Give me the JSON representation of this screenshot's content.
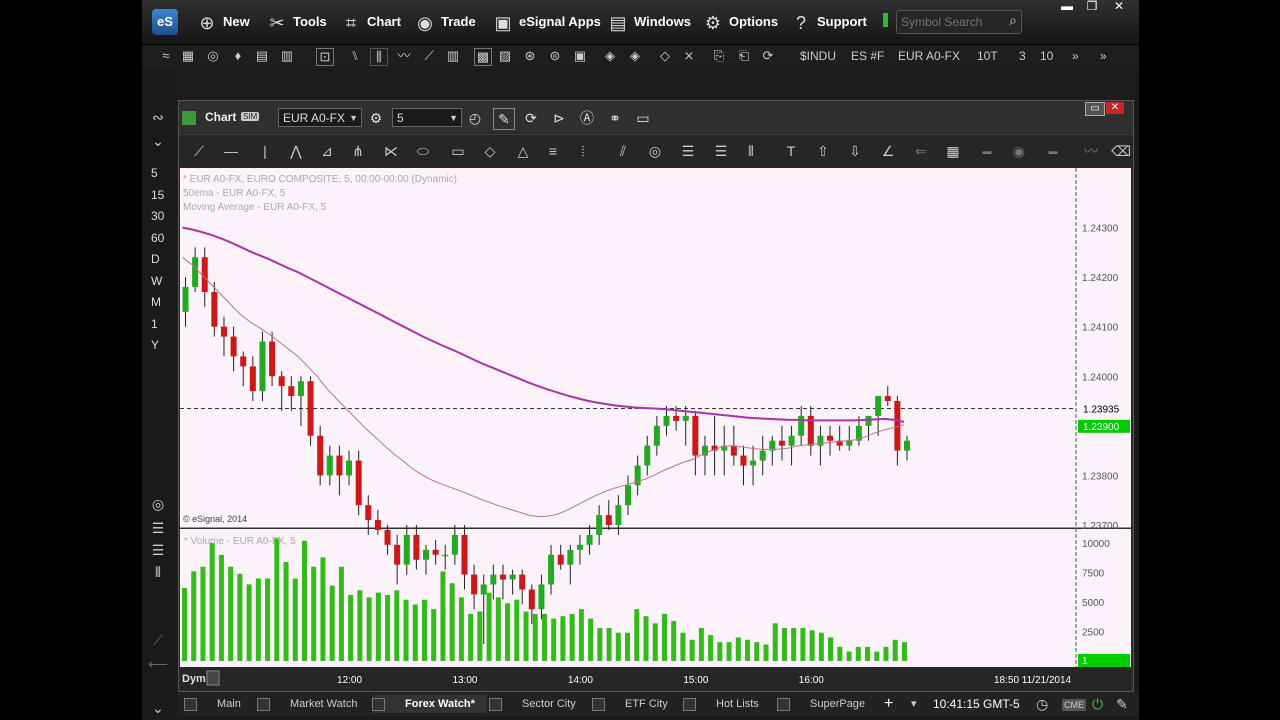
{
  "menu": {
    "logo": "eS",
    "items": [
      "New",
      "Tools",
      "Chart",
      "Trade",
      "eSignal Apps",
      "Windows",
      "Options",
      "Support"
    ],
    "search_placeholder": "Symbol Search"
  },
  "toolbar": {
    "symbols": [
      "$INDU",
      "ES #F",
      "EUR A0-FX",
      "10T",
      "3",
      "10"
    ]
  },
  "gutter": {
    "intervals": [
      "5",
      "15",
      "30",
      "60",
      "D",
      "W",
      "M",
      "1",
      "Y"
    ]
  },
  "chart_window": {
    "title": "Chart",
    "mode_badge": "SIM",
    "symbol": "EUR A0-FX",
    "interval": "5"
  },
  "colors": {
    "up": "#22aa22",
    "down": "#cc1818",
    "ma50": "#aa33aa",
    "ma": "#c07088",
    "volume": "#33bb1a",
    "plot_bg": "#fcf2fa",
    "last_price": "#00cc00"
  },
  "chart_data": [
    {
      "type": "candlestick",
      "title": "* EUR A0-FX, EURO COMPOSITE, 5, 00:00-00:00 (Dynamic)",
      "studies": [
        "50ema - EUR A0-FX, 5",
        "Moving Average - EUR A0-FX, 5"
      ],
      "watermark": "© eSignal, 2014",
      "ylim": [
        1.237,
        1.2442
      ],
      "yticks": [
        "1.24300",
        "1.24200",
        "1.24100",
        "1.24000",
        "1.23800",
        "1.23700"
      ],
      "ytick_values": [
        1.243,
        1.242,
        1.241,
        1.24,
        1.238,
        1.237
      ],
      "crosshair_price": "1.23935",
      "crosshair_value": 1.23935,
      "last_price": "1.23900",
      "last_value": 1.239,
      "candles": [
        [
          1.2413,
          1.242,
          1.241,
          1.2418
        ],
        [
          1.2418,
          1.2426,
          1.2417,
          1.2424
        ],
        [
          1.2424,
          1.2426,
          1.2414,
          1.2417
        ],
        [
          1.2417,
          1.2419,
          1.2408,
          1.241
        ],
        [
          1.241,
          1.2412,
          1.2404,
          1.2408
        ],
        [
          1.2408,
          1.241,
          1.2401,
          1.2404
        ],
        [
          1.2404,
          1.2405,
          1.2398,
          1.2402
        ],
        [
          1.2402,
          1.2404,
          1.2395,
          1.2397
        ],
        [
          1.2397,
          1.2409,
          1.2395,
          1.2407
        ],
        [
          1.2407,
          1.2409,
          1.2398,
          1.24
        ],
        [
          1.24,
          1.2401,
          1.2393,
          1.2398
        ],
        [
          1.2398,
          1.24,
          1.2393,
          1.2396
        ],
        [
          1.2396,
          1.24,
          1.239,
          1.2399
        ],
        [
          1.2399,
          1.24,
          1.2386,
          1.2388
        ],
        [
          1.2388,
          1.239,
          1.2378,
          1.238
        ],
        [
          1.238,
          1.2386,
          1.2378,
          1.2384
        ],
        [
          1.2384,
          1.2386,
          1.2376,
          1.238
        ],
        [
          1.238,
          1.2385,
          1.2378,
          1.2383
        ],
        [
          1.2383,
          1.2385,
          1.2372,
          1.2374
        ],
        [
          1.2374,
          1.2376,
          1.2368,
          1.2371
        ],
        [
          1.2371,
          1.2373,
          1.2368,
          1.2369
        ],
        [
          1.2369,
          1.237,
          1.2364,
          1.2366
        ],
        [
          1.2366,
          1.2368,
          1.2358,
          1.2362
        ],
        [
          1.2362,
          1.237,
          1.236,
          1.2368
        ],
        [
          1.2368,
          1.237,
          1.2361,
          1.2363
        ],
        [
          1.2363,
          1.2366,
          1.236,
          1.2365
        ],
        [
          1.2365,
          1.2367,
          1.2362,
          1.2364
        ],
        [
          1.2364,
          1.2366,
          1.2361,
          1.2364
        ],
        [
          1.2364,
          1.237,
          1.2362,
          1.2368
        ],
        [
          1.2368,
          1.237,
          1.2357,
          1.236
        ],
        [
          1.236,
          1.2362,
          1.2353,
          1.2356
        ],
        [
          1.2356,
          1.236,
          1.2346,
          1.2358
        ],
        [
          1.2358,
          1.2362,
          1.2355,
          1.236
        ],
        [
          1.236,
          1.2362,
          1.2355,
          1.2359
        ],
        [
          1.2359,
          1.2361,
          1.2356,
          1.236
        ],
        [
          1.236,
          1.2361,
          1.2354,
          1.2357
        ],
        [
          1.2357,
          1.2358,
          1.235,
          1.2353
        ],
        [
          1.2353,
          1.236,
          1.2351,
          1.2358
        ],
        [
          1.2358,
          1.2366,
          1.2356,
          1.2364
        ],
        [
          1.2364,
          1.2366,
          1.2361,
          1.2362
        ],
        [
          1.2362,
          1.2366,
          1.2358,
          1.2365
        ],
        [
          1.2365,
          1.2368,
          1.2362,
          1.2366
        ],
        [
          1.2366,
          1.237,
          1.2364,
          1.2368
        ],
        [
          1.2368,
          1.2374,
          1.2366,
          1.2372
        ],
        [
          1.2372,
          1.2375,
          1.2369,
          1.237
        ],
        [
          1.237,
          1.2376,
          1.2368,
          1.2374
        ],
        [
          1.2374,
          1.238,
          1.2372,
          1.2378
        ],
        [
          1.2378,
          1.2384,
          1.2376,
          1.2382
        ],
        [
          1.2382,
          1.2388,
          1.238,
          1.2386
        ],
        [
          1.2386,
          1.2392,
          1.2384,
          1.239
        ],
        [
          1.239,
          1.2394,
          1.2388,
          1.2392
        ],
        [
          1.2392,
          1.2394,
          1.2389,
          1.2391
        ],
        [
          1.2391,
          1.2394,
          1.2386,
          1.2392
        ],
        [
          1.2392,
          1.2393,
          1.238,
          1.2384
        ],
        [
          1.2384,
          1.2388,
          1.238,
          1.2386
        ],
        [
          1.2386,
          1.2392,
          1.238,
          1.2385
        ],
        [
          1.2385,
          1.239,
          1.238,
          1.2386
        ],
        [
          1.2386,
          1.239,
          1.2382,
          1.2384
        ],
        [
          1.2384,
          1.2386,
          1.2378,
          1.2382
        ],
        [
          1.2382,
          1.2386,
          1.2378,
          1.2383
        ],
        [
          1.2383,
          1.2388,
          1.238,
          1.2385
        ],
        [
          1.2385,
          1.2388,
          1.2382,
          1.2387
        ],
        [
          1.2387,
          1.239,
          1.2383,
          1.2386
        ],
        [
          1.2386,
          1.239,
          1.2382,
          1.2388
        ],
        [
          1.2388,
          1.2394,
          1.2386,
          1.2392
        ],
        [
          1.2392,
          1.2394,
          1.2384,
          1.2386
        ],
        [
          1.2386,
          1.239,
          1.2382,
          1.2388
        ],
        [
          1.2388,
          1.239,
          1.2384,
          1.2387
        ],
        [
          1.2387,
          1.239,
          1.2385,
          1.2386
        ],
        [
          1.2386,
          1.239,
          1.2385,
          1.2387
        ],
        [
          1.2387,
          1.2392,
          1.2386,
          1.239
        ],
        [
          1.239,
          1.2392,
          1.2387,
          1.2392
        ],
        [
          1.2392,
          1.2396,
          1.2388,
          1.2396
        ],
        [
          1.2396,
          1.2398,
          1.2394,
          1.2395
        ],
        [
          1.2395,
          1.2396,
          1.2382,
          1.2385
        ],
        [
          1.2385,
          1.2388,
          1.2383,
          1.2387
        ]
      ],
      "series": [
        {
          "name": "50ema - EUR A0-FX, 5",
          "values": [
            1.243,
            1.24296,
            1.24291,
            1.24285,
            1.24278,
            1.2427,
            1.24261,
            1.24252,
            1.24244,
            1.24236,
            1.24227,
            1.24218,
            1.2421,
            1.242,
            1.2419,
            1.2418,
            1.2417,
            1.2416,
            1.2415,
            1.2414,
            1.2413,
            1.2412,
            1.2411,
            1.241,
            1.2409,
            1.2408,
            1.24071,
            1.24062,
            1.24054,
            1.24045,
            1.24036,
            1.24027,
            1.24019,
            1.24011,
            1.24003,
            1.23995,
            1.23987,
            1.2398,
            1.23973,
            1.23967,
            1.23961,
            1.23956,
            1.23951,
            1.23947,
            1.23944,
            1.23941,
            1.23939,
            1.23937,
            1.23936,
            1.23935,
            1.23934,
            1.23932,
            1.2393,
            1.23928,
            1.23926,
            1.23924,
            1.23922,
            1.2392,
            1.23918,
            1.23916,
            1.23915,
            1.23914,
            1.23913,
            1.23912,
            1.23912,
            1.23911,
            1.23911,
            1.23911,
            1.23911,
            1.23911,
            1.23911,
            1.23912,
            1.23913,
            1.23914,
            1.23912,
            1.23908
          ]
        },
        {
          "name": "Moving Average - EUR A0-FX, 5",
          "values": [
            1.2424,
            1.24225,
            1.24205,
            1.24185,
            1.24165,
            1.24145,
            1.24125,
            1.2411,
            1.24098,
            1.24085,
            1.2407,
            1.24055,
            1.2404,
            1.2402,
            1.24,
            1.23975,
            1.23955,
            1.23935,
            1.23915,
            1.23895,
            1.23878,
            1.2386,
            1.23843,
            1.23828,
            1.23812,
            1.238,
            1.2379,
            1.23782,
            1.23775,
            1.23768,
            1.2376,
            1.23752,
            1.23745,
            1.23738,
            1.23732,
            1.23726,
            1.2372,
            1.23717,
            1.23718,
            1.23722,
            1.2373,
            1.2374,
            1.2375,
            1.2376,
            1.23768,
            1.23775,
            1.2378,
            1.23786,
            1.23792,
            1.238,
            1.2381,
            1.23818,
            1.23826,
            1.23832,
            1.23842,
            1.2385,
            1.23857,
            1.2386,
            1.23858,
            1.23855,
            1.23853,
            1.23852,
            1.23853,
            1.23855,
            1.2386,
            1.23862,
            1.23864,
            1.23866,
            1.23868,
            1.2387,
            1.23872,
            1.23878,
            1.23886,
            1.23892,
            1.23897,
            1.23902
          ]
        }
      ]
    },
    {
      "type": "bar",
      "title": "* Volume - EUR A0-FX, 5",
      "ylim": [
        0,
        11200
      ],
      "yticks": [
        "10000",
        "7500",
        "5000",
        "2500"
      ],
      "ytick_values": [
        10000,
        7500,
        5000,
        2500
      ],
      "last_value_label": "1",
      "values": [
        6200,
        7600,
        8000,
        10000,
        9000,
        8000,
        7400,
        6500,
        7000,
        7000,
        10400,
        8400,
        7000,
        10200,
        8000,
        8800,
        6400,
        8000,
        5600,
        6000,
        5400,
        5800,
        5600,
        6000,
        5200,
        4800,
        5200,
        4400,
        7600,
        6600,
        5400,
        4000,
        4200,
        5800,
        5400,
        4900,
        5200,
        4200,
        4000,
        4000,
        3600,
        3800,
        4000,
        4400,
        3600,
        2800,
        2800,
        2400,
        2400,
        4400,
        3800,
        3200,
        4000,
        3400,
        2400,
        1800,
        2800,
        2200,
        1600,
        1600,
        2000,
        1800,
        1600,
        1400,
        3200,
        2800,
        2800,
        2800,
        2600,
        2400,
        2000,
        1200,
        800,
        1200,
        1200,
        800,
        1200,
        1800,
        1600
      ],
      "x_tick_labels": [
        "12:00",
        "13:00",
        "14:00",
        "15:00",
        "16:00"
      ],
      "x_label_left": "Dym",
      "x_label_right": "18:50 11/21/2014"
    }
  ],
  "tabs": {
    "items": [
      "Main",
      "Market Watch",
      "Forex Watch*",
      "Sector City",
      "ETF City",
      "Hot Lists",
      "SuperPage"
    ],
    "active": "Forex Watch*",
    "clock": "10:41:15 GMT-5"
  }
}
